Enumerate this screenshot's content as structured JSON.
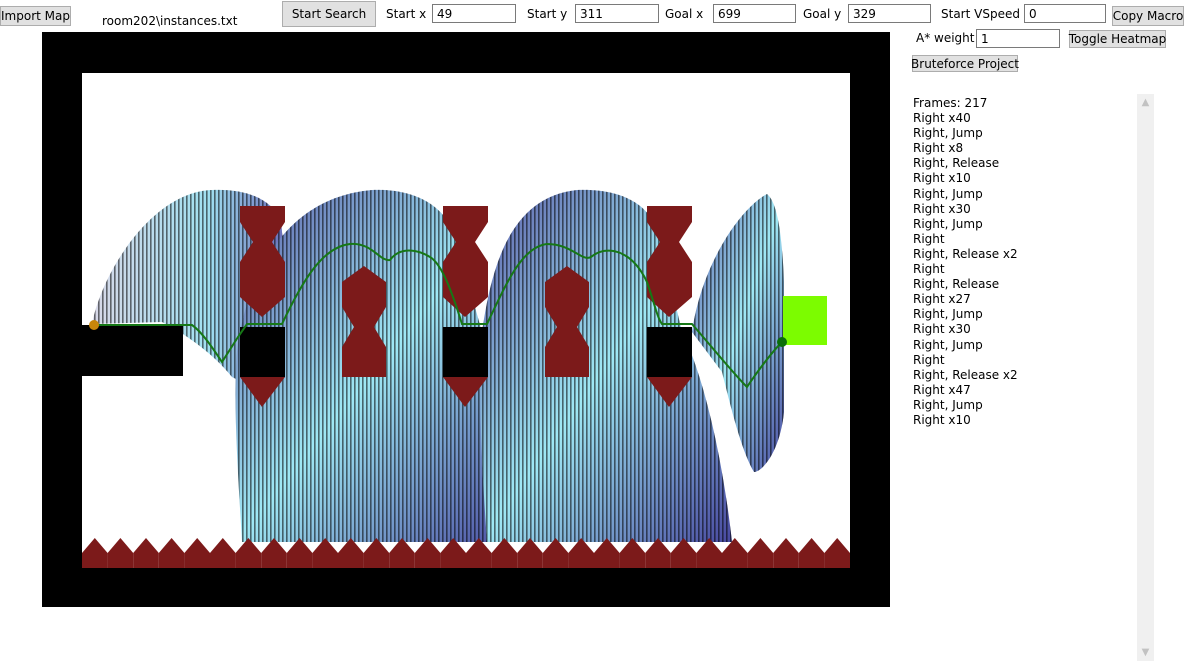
{
  "toolbar": {
    "import_map_label": "Import Map",
    "file_path": "room202\\instances.txt",
    "start_search_label": "Start Search",
    "start_x_label": "Start x",
    "start_x_value": "49",
    "start_y_label": "Start y",
    "start_y_value": "311",
    "goal_x_label": "Goal x",
    "goal_x_value": "699",
    "goal_y_label": "Goal y",
    "goal_y_value": "329",
    "start_vspeed_label": "Start VSpeed",
    "start_vspeed_value": "0",
    "copy_macro_label": "Copy Macro",
    "astar_weight_label": "A* weight",
    "astar_weight_value": "1",
    "toggle_heatmap_label": "Toggle Heatmap",
    "bruteforce_label": "Bruteforce Project"
  },
  "map": {
    "colors": {
      "border": "#000000",
      "background": "#ffffff",
      "spike": "#7c1a1a",
      "block": "#000000",
      "goal": "#7cfc00",
      "path": "#167816",
      "start_marker": "#c8860a",
      "goal_marker": "#0a6e0a",
      "heatmap_dark": "#3a3a8c",
      "heatmap_light": "#8fe4f0"
    }
  },
  "macro_log": {
    "lines": [
      "Frames: 217",
      "Right x40",
      "Right, Jump",
      "Right x8",
      "Right, Release",
      "Right x10",
      "Right, Jump",
      "Right x30",
      "Right, Jump",
      "Right",
      "Right, Release x2",
      "Right",
      "Right, Release",
      "Right x27",
      "Right, Jump",
      "Right x30",
      "Right, Jump",
      "Right",
      "Right, Release x2",
      "Right x47",
      "Right, Jump",
      "Right x10"
    ]
  },
  "scrollbar": {
    "up_icon": "chevron-up-icon",
    "down_icon": "chevron-down-icon"
  }
}
